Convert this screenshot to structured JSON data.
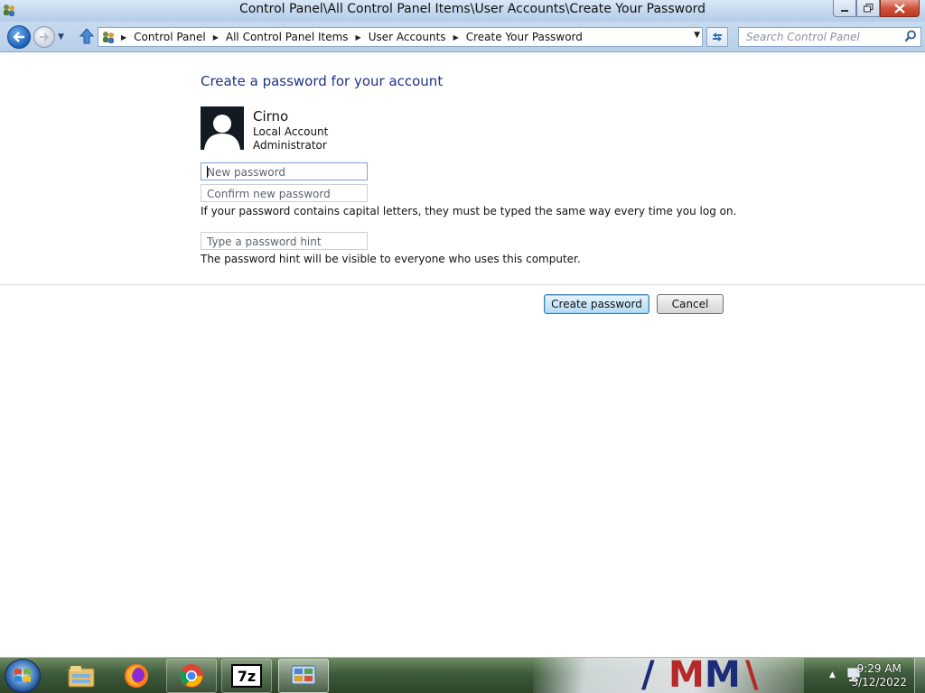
{
  "window": {
    "title": "Control Panel\\All Control Panel Items\\User Accounts\\Create Your Password",
    "controls": {
      "minimize_icon": "minimize-icon",
      "restore_icon": "restore-icon",
      "close_icon": "close-icon"
    }
  },
  "navigation": {
    "breadcrumbs": [
      "Control Panel",
      "All Control Panel Items",
      "User Accounts",
      "Create Your Password"
    ],
    "search_placeholder": "Search Control Panel"
  },
  "main": {
    "heading": "Create a password for your account",
    "user": {
      "name": "Cirno",
      "account_type": "Local Account",
      "role": "Administrator"
    },
    "fields": {
      "new_password_placeholder": "New password",
      "confirm_password_placeholder": "Confirm new password",
      "hint_placeholder": "Type a password hint"
    },
    "notes": {
      "capitals": "If your password contains capital letters, they must be typed the same way every time you log on.",
      "hint_visibility": "The password hint will be visible to everyone who uses this computer."
    },
    "buttons": {
      "create": "Create password",
      "cancel": "Cancel"
    }
  },
  "taskbar": {
    "items": [
      "windows-explorer-icon",
      "firefox-icon",
      "chrome-icon",
      "7zip-icon",
      "control-panel-icon"
    ],
    "seven_zip_label": "7z",
    "clock": {
      "time": "9:29 AM",
      "date": "3/12/2022"
    }
  },
  "colors": {
    "heading": "#1e3287",
    "primary_button_border": "#3c7fb1",
    "titlebar": "#c3d7ee"
  }
}
